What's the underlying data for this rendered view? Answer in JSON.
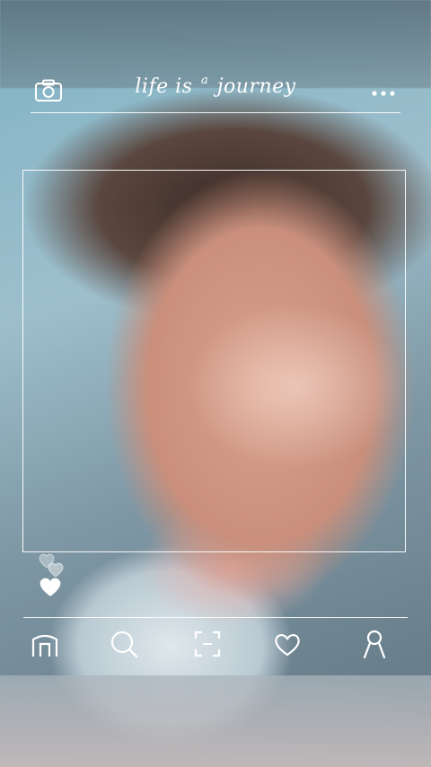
{
  "header": {
    "title_prefix": "life is",
    "title_sup": "a",
    "title_suffix": "journey",
    "left_icon": "camera-icon",
    "right_icon": "more-dots-icon"
  },
  "reactions": {
    "icons": [
      "heart-outline-icon",
      "heart-outline-icon",
      "heart-filled-icon"
    ]
  },
  "nav": {
    "items": [
      {
        "name": "home",
        "icon": "home-icon"
      },
      {
        "name": "search",
        "icon": "search-icon"
      },
      {
        "name": "scan",
        "icon": "scan-icon"
      },
      {
        "name": "likes",
        "icon": "heart-icon"
      },
      {
        "name": "profile",
        "icon": "profile-icon"
      }
    ]
  },
  "colors": {
    "overlay_line": "#ffffff"
  }
}
